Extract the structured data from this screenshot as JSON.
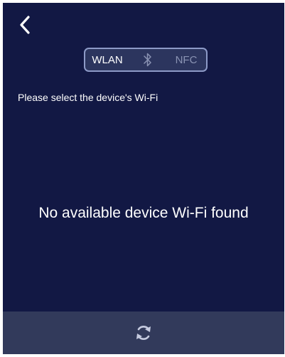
{
  "header": {
    "back_icon": "chevron-left-icon"
  },
  "mode_switch": {
    "options": [
      {
        "label": "WLAN",
        "selected": true
      },
      {
        "label": "",
        "icon": "bluetooth-icon",
        "selected": false
      },
      {
        "label": "NFC",
        "selected": false
      }
    ]
  },
  "main": {
    "instruction": "Please select the device's Wi-Fi",
    "empty_message": "No available device Wi-Fi found"
  },
  "footer": {
    "refresh_icon": "refresh-icon"
  },
  "colors": {
    "background": "#121844",
    "bottom_bar": "#323a5b",
    "selected_text": "#ffffff",
    "inactive_text": "#8a93b3",
    "switch_border": "#8d9ac7"
  }
}
